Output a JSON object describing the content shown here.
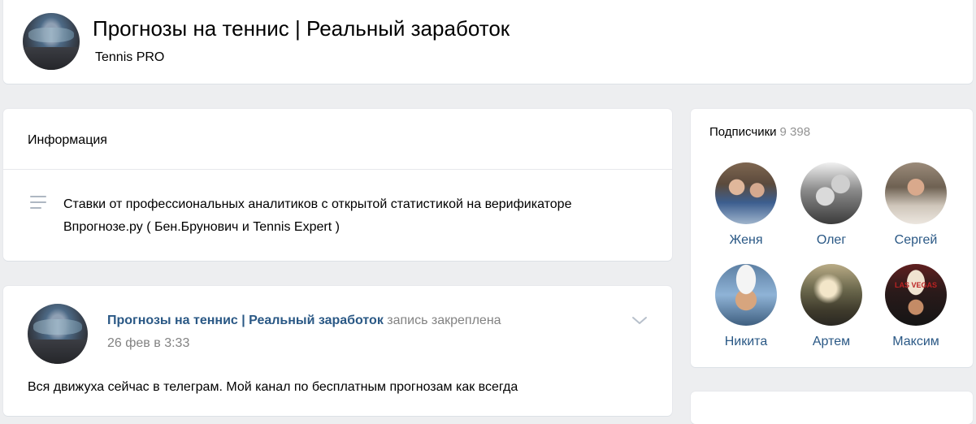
{
  "header": {
    "title": "Прогнозы на теннис | Реальный заработок",
    "subtitle": "Tennis PRO"
  },
  "info": {
    "heading": "Информация",
    "description": "Ставки от профессиональных аналитиков с открытой статистикой на верификаторе Впрогнозе.ру ( Бен.Брунович и Tennis Expert )"
  },
  "post": {
    "author_name": "Прогнозы на теннис | Реальный заработок",
    "author_action": "запись закреплена",
    "date": "26 фев в 3:33",
    "text": "Вся движуха сейчас в телеграм. Мой канал по бесплатным прогнозам как всегда"
  },
  "subscribers": {
    "title": "Подписчики",
    "count": "9 398",
    "items": [
      {
        "name": "Женя"
      },
      {
        "name": "Олег"
      },
      {
        "name": "Сергей"
      },
      {
        "name": "Никита"
      },
      {
        "name": "Артем"
      },
      {
        "name": "Максим"
      }
    ],
    "sign_text": "LAS VEGAS"
  },
  "colors": {
    "background": "#edeef0",
    "link": "#2a5885",
    "muted": "#828282"
  }
}
